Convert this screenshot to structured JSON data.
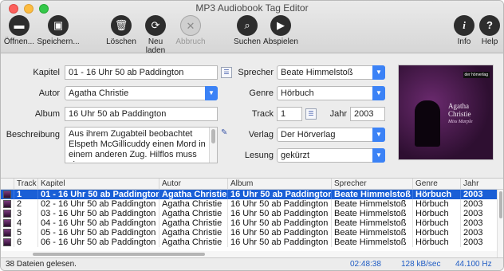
{
  "window": {
    "title": "MP3 Audiobook Tag Editor"
  },
  "toolbar": {
    "open": "Öffnen...",
    "save": "Speichern...",
    "delete": "Löschen",
    "reload": "Neu laden",
    "abort": "Abbruch",
    "search": "Suchen",
    "play": "Abspielen",
    "info": "Info",
    "help": "Help"
  },
  "form": {
    "kapitel_label": "Kapitel",
    "kapitel_value": "01 - 16 Uhr 50 ab Paddington",
    "autor_label": "Autor",
    "autor_value": "Agatha Christie",
    "album_label": "Album",
    "album_value": "16 Uhr 50 ab Paddington",
    "beschreibung_label": "Beschreibung",
    "beschreibung_value": "Aus ihrem Zugabteil beobachtet Elspeth McGillicuddy einen Mord in einem anderen Zug. Hilflos muss sie",
    "sprecher_label": "Sprecher",
    "sprecher_value": "Beate Himmelstoß",
    "genre_label": "Genre",
    "genre_value": "Hörbuch",
    "track_label": "Track",
    "track_value": "1",
    "jahr_label": "Jahr",
    "jahr_value": "2003",
    "verlag_label": "Verlag",
    "verlag_value": "Der Hörverlag",
    "lesung_label": "Lesung",
    "lesung_value": "gekürzt"
  },
  "cover": {
    "publisher": "der hörverlag",
    "author": "Agatha Christie",
    "subtitle": "Miss Marple"
  },
  "table": {
    "columns": [
      "Track",
      "Kapitel",
      "Autor",
      "Album",
      "Sprecher",
      "Genre",
      "Jahr"
    ],
    "rows": [
      {
        "track": "1",
        "kapitel": "01 - 16 Uhr 50 ab Paddington",
        "autor": "Agatha Christie",
        "album": "16 Uhr 50 ab Paddington",
        "sprecher": "Beate Himmelstoß",
        "genre": "Hörbuch",
        "jahr": "2003"
      },
      {
        "track": "2",
        "kapitel": "02 - 16 Uhr 50 ab Paddington",
        "autor": "Agatha Christie",
        "album": "16 Uhr 50 ab Paddington",
        "sprecher": "Beate Himmelstoß",
        "genre": "Hörbuch",
        "jahr": "2003"
      },
      {
        "track": "3",
        "kapitel": "03 - 16 Uhr 50 ab Paddington",
        "autor": "Agatha Christie",
        "album": "16 Uhr 50 ab Paddington",
        "sprecher": "Beate Himmelstoß",
        "genre": "Hörbuch",
        "jahr": "2003"
      },
      {
        "track": "4",
        "kapitel": "04 - 16 Uhr 50 ab Paddington",
        "autor": "Agatha Christie",
        "album": "16 Uhr 50 ab Paddington",
        "sprecher": "Beate Himmelstoß",
        "genre": "Hörbuch",
        "jahr": "2003"
      },
      {
        "track": "5",
        "kapitel": "05 - 16 Uhr 50 ab Paddington",
        "autor": "Agatha Christie",
        "album": "16 Uhr 50 ab Paddington",
        "sprecher": "Beate Himmelstoß",
        "genre": "Hörbuch",
        "jahr": "2003"
      },
      {
        "track": "6",
        "kapitel": "06 - 16 Uhr 50 ab Paddington",
        "autor": "Agatha Christie",
        "album": "16 Uhr 50 ab Paddington",
        "sprecher": "Beate Himmelstoß",
        "genre": "Hörbuch",
        "jahr": "2003"
      }
    ]
  },
  "status": {
    "message": "38 Dateien gelesen.",
    "duration": "02:48:38",
    "bitrate": "128 kB/sec",
    "samplerate": "44.100 Hz"
  },
  "colors": {
    "selection": "#1a5fd6",
    "accent": "#3b82f6"
  }
}
